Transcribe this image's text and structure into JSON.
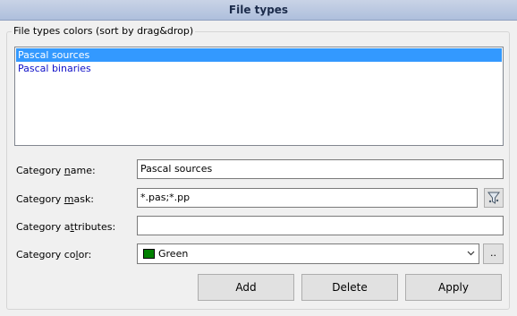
{
  "title": "File types",
  "group_title": "File types colors (sort by drag&drop)",
  "list": {
    "items": [
      {
        "label": "Pascal sources",
        "selected": true
      },
      {
        "label": "Pascal binaries",
        "selected": false
      }
    ]
  },
  "fields": {
    "name": {
      "label_pre": "Category ",
      "label_key": "n",
      "label_post": "ame:",
      "value": "Pascal sources"
    },
    "mask": {
      "label_pre": "Category ",
      "label_key": "m",
      "label_post": "ask:",
      "value": "*.pas;*.pp",
      "icon": "filter-icon"
    },
    "attributes": {
      "label_pre": "Category a",
      "label_key": "t",
      "label_post": "tributes:",
      "value": ""
    },
    "color": {
      "label_pre": "Category co",
      "label_key": "l",
      "label_post": "or:",
      "value": "Green",
      "swatch_color": "#008000",
      "more_label": ".."
    }
  },
  "buttons": {
    "add": "Add",
    "delete": "Delete",
    "apply": "Apply"
  },
  "colors": {
    "selection": "#3399ff",
    "list_text": "#1010c8",
    "title_bar": "#b9c7e0"
  }
}
